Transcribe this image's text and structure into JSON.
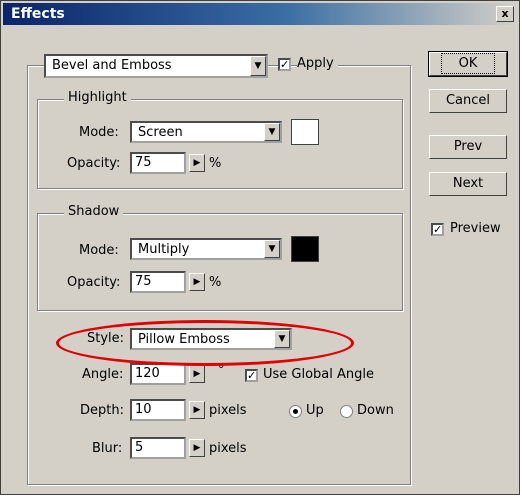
{
  "window": {
    "title": "Effects",
    "close_label": "x"
  },
  "effect": {
    "selected": "Bevel and Emboss",
    "apply_label": "Apply",
    "apply_checked": true
  },
  "highlight": {
    "title": "Highlight",
    "mode_label": "Mode:",
    "mode_value": "Screen",
    "opacity_label": "Opacity:",
    "opacity_value": "75",
    "percent": "%",
    "color": "#ffffff"
  },
  "shadow": {
    "title": "Shadow",
    "mode_label": "Mode:",
    "mode_value": "Multiply",
    "opacity_label": "Opacity:",
    "opacity_value": "75",
    "percent": "%",
    "color": "#000000"
  },
  "style": {
    "label": "Style:",
    "value": "Pillow Emboss"
  },
  "angle": {
    "label": "Angle:",
    "value": "120",
    "degree": "°",
    "global_label": "Use Global Angle",
    "global_checked": true
  },
  "depth": {
    "label": "Depth:",
    "value": "10",
    "unit": "pixels",
    "up_label": "Up",
    "down_label": "Down",
    "direction": "Up"
  },
  "blur": {
    "label": "Blur:",
    "value": "5",
    "unit": "pixels"
  },
  "buttons": {
    "ok": "OK",
    "cancel": "Cancel",
    "prev": "Prev",
    "next": "Next"
  },
  "preview": {
    "label": "Preview",
    "checked": true
  },
  "annotation": {
    "color": "#e00000"
  }
}
